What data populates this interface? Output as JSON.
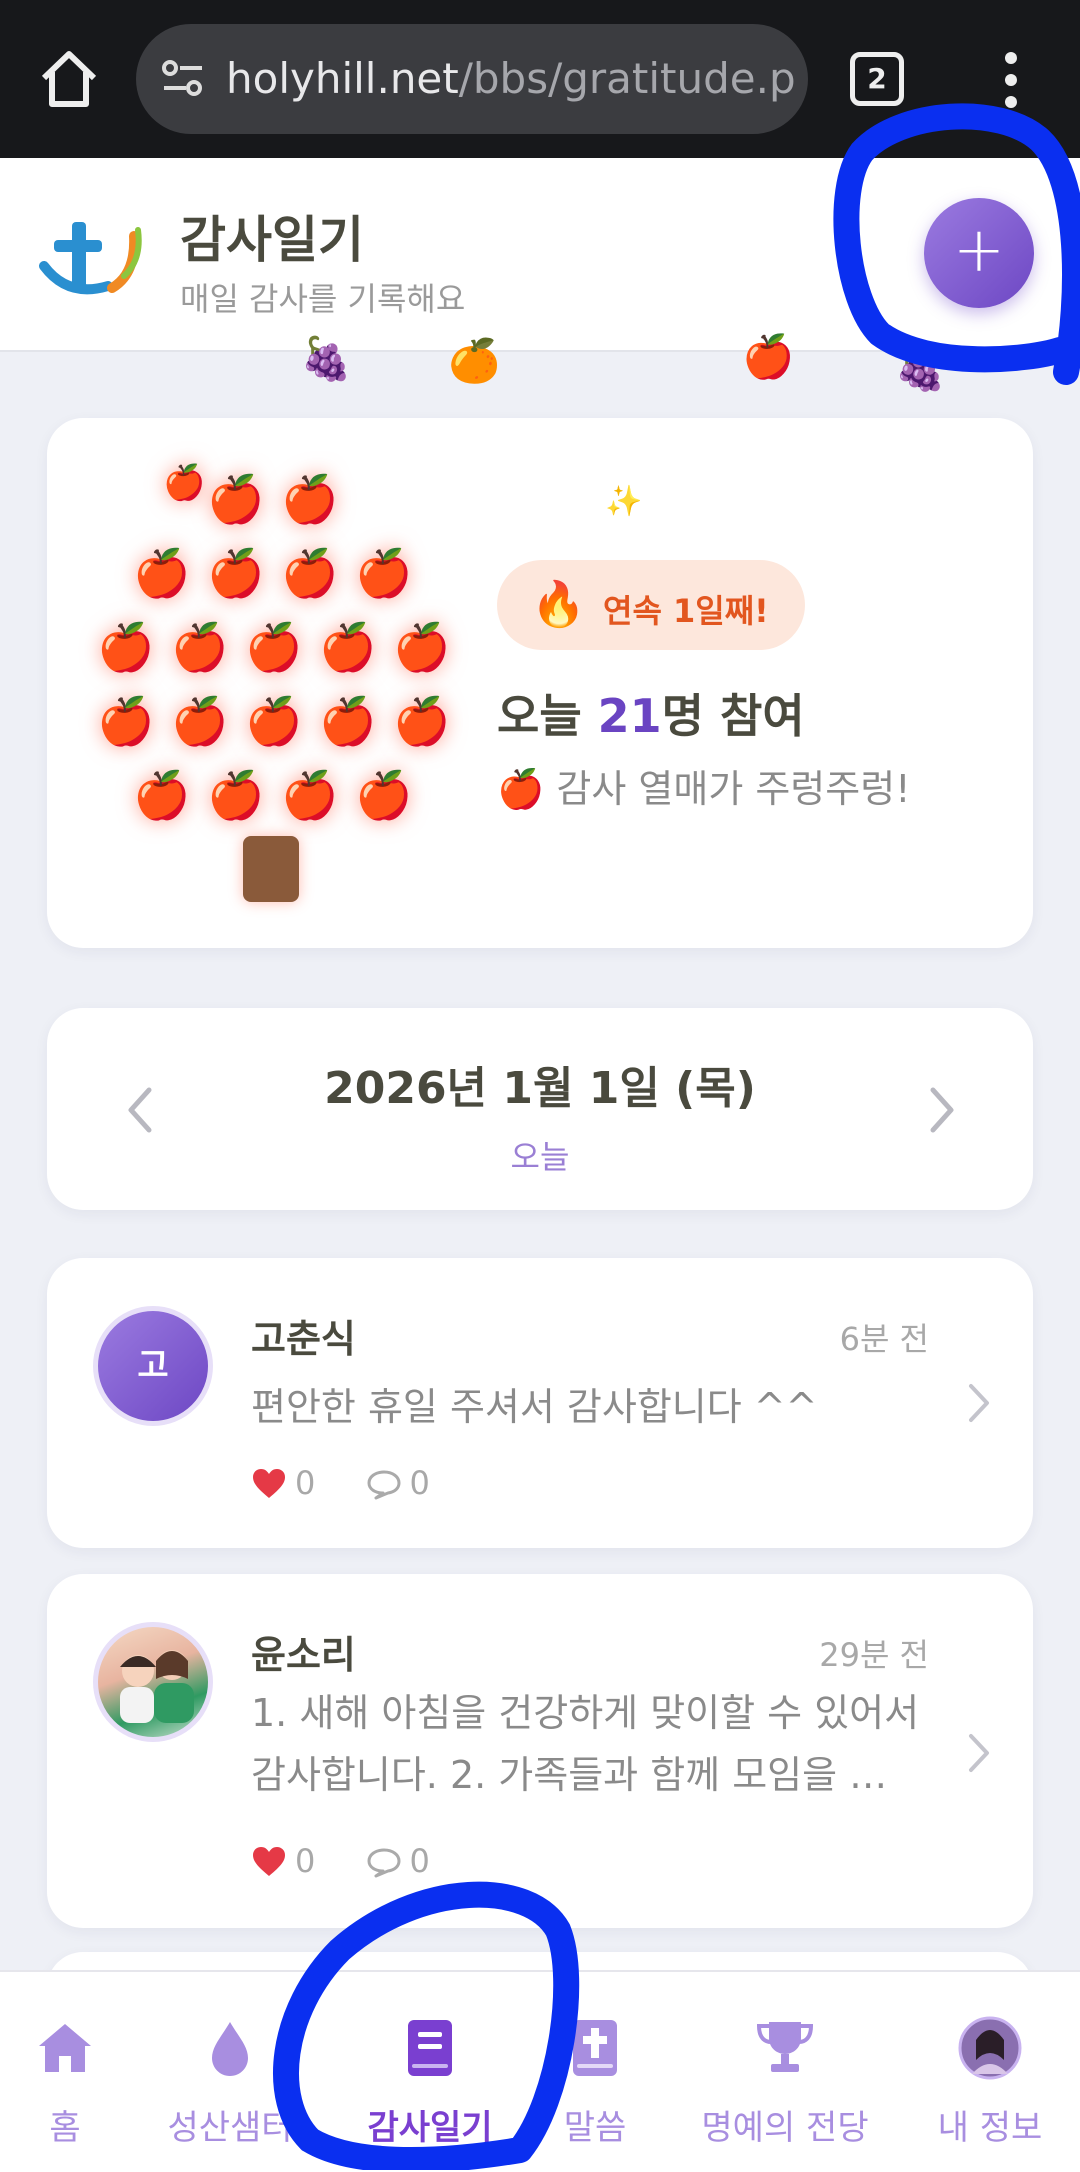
{
  "browser": {
    "url_domain": "holyhill.net",
    "url_path": "/bbs/gratitude.ph",
    "tab_count": "2"
  },
  "header": {
    "title": "감사일기",
    "subtitle": "매일 감사를 기록해요",
    "add_label": "+"
  },
  "tree_card": {
    "streak_label": "연속 1일째!",
    "participants_prefix": "오늘 ",
    "participants_count": "21",
    "participants_suffix": "명 참여",
    "fruit_message": "🍎 감사 열매가 주렁주렁!"
  },
  "date_nav": {
    "date": "2026년 1월 1일 (목)",
    "relative": "오늘"
  },
  "posts": [
    {
      "avatar_letter": "고",
      "name": "고춘식",
      "time": "6분 전",
      "body": "편안한 휴일 주셔서 감사합니다 ^^",
      "likes": "0",
      "comments": "0"
    },
    {
      "name": "윤소리",
      "time": "29분 전",
      "body": "1. 새해 아침을 건강하게 맞이할 수 있어서 감사합니다. 2. 가족들과 함께 모임을 …",
      "likes": "0",
      "comments": "0"
    }
  ],
  "nav": {
    "items": [
      {
        "label": "홈",
        "icon": "home-icon"
      },
      {
        "label": "성산샘터",
        "icon": "droplet-icon"
      },
      {
        "label": "감사일기",
        "icon": "book-icon"
      },
      {
        "label": "말씀",
        "icon": "bible-icon"
      },
      {
        "label": "명예의 전당",
        "icon": "trophy-icon"
      },
      {
        "label": "내 정보",
        "icon": "profile-avatar-icon"
      }
    ],
    "active": "감사일기"
  },
  "colors": {
    "accent": "#7a3fd0",
    "streak": "#e2561f",
    "annotation": "#0a2ff0"
  }
}
